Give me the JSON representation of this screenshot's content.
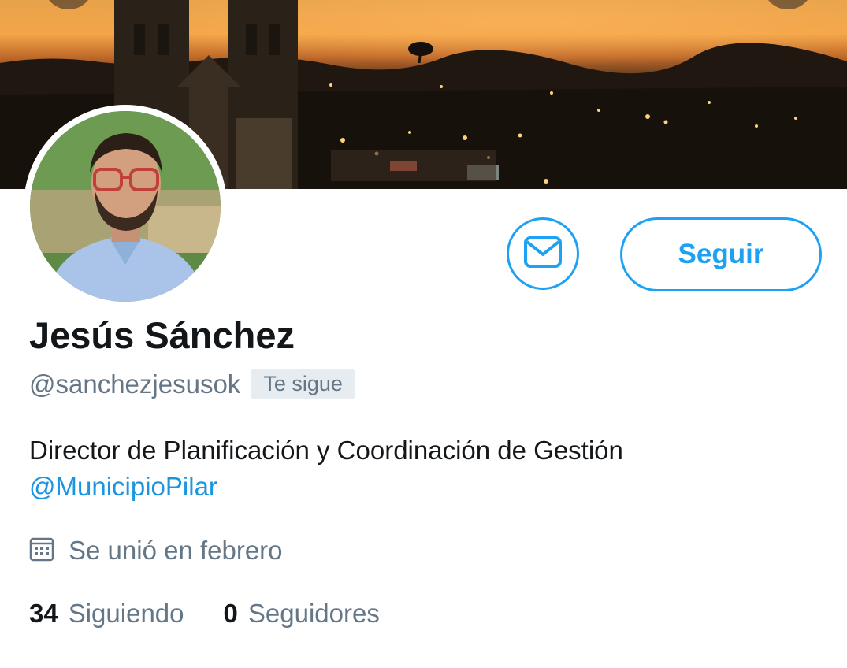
{
  "profile": {
    "name": "Jesús Sánchez",
    "handle": "@sanchezjesusok",
    "follows_you_badge": "Te sigue",
    "bio_text": "Director de Planificación y Coordinación de Gestión",
    "bio_mention": "@MunicipioPilar",
    "joined": "Se unió en febrero"
  },
  "actions": {
    "message_icon": "envelope-icon",
    "follow_label": "Seguir"
  },
  "stats": {
    "following_count": "34",
    "following_label": "Siguiendo",
    "followers_count": "0",
    "followers_label": "Seguidores"
  },
  "icons": {
    "joined": "calendar-icon"
  },
  "colors": {
    "accent": "#1da1f2",
    "mention": "#1b95e0",
    "secondary_text": "#657786",
    "primary_text": "#14171a",
    "badge_bg": "#e6ecf0"
  }
}
